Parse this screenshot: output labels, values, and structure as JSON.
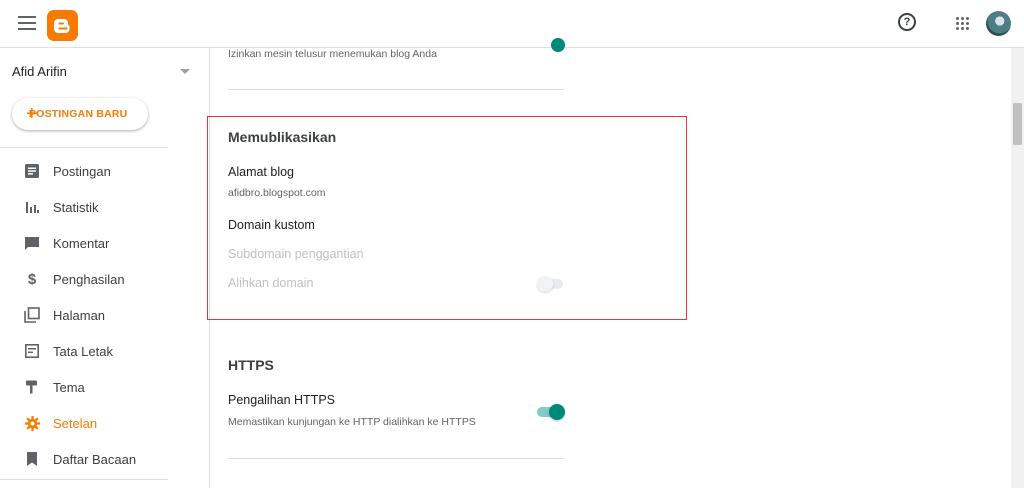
{
  "header": {
    "menu_icon": "menu-icon",
    "logo_icon": "blogger-logo",
    "help_icon": "help-icon",
    "apps_icon": "apps-grid-icon",
    "avatar_icon": "user-avatar"
  },
  "sidebar": {
    "blog_name": "Afid Arifin",
    "new_post_label": "POSTINGAN BARU",
    "items": [
      {
        "label": "Postingan",
        "icon": "posts-icon"
      },
      {
        "label": "Statistik",
        "icon": "stats-icon"
      },
      {
        "label": "Komentar",
        "icon": "comment-icon"
      },
      {
        "label": "Penghasilan",
        "icon": "dollar-icon"
      },
      {
        "label": "Halaman",
        "icon": "pages-icon"
      },
      {
        "label": "Tata Letak",
        "icon": "layout-icon"
      },
      {
        "label": "Tema",
        "icon": "theme-icon"
      },
      {
        "label": "Setelan",
        "icon": "gear-icon",
        "active": true
      },
      {
        "label": "Daftar Bacaan",
        "icon": "bookmark-icon"
      }
    ]
  },
  "main": {
    "prev_description": "Izinkan mesin telusur menemukan blog Anda",
    "publish": {
      "title": "Memublikasikan",
      "blog_address_label": "Alamat blog",
      "blog_address_value": "afidbro.blogspot.com",
      "custom_domain_label": "Domain kustom",
      "replacement_subdomain_label": "Subdomain penggantian",
      "redirect_domain_label": "Alihkan domain",
      "redirect_domain_on": false
    },
    "https": {
      "title": "HTTPS",
      "redirect_label": "Pengalihan HTTPS",
      "redirect_desc": "Memastikan kunjungan ke HTTP dialihkan ke HTTPS",
      "redirect_on": true
    }
  },
  "colors": {
    "accent": "#f57c00",
    "toggle_on": "#00897b",
    "highlight": "#e53935"
  }
}
